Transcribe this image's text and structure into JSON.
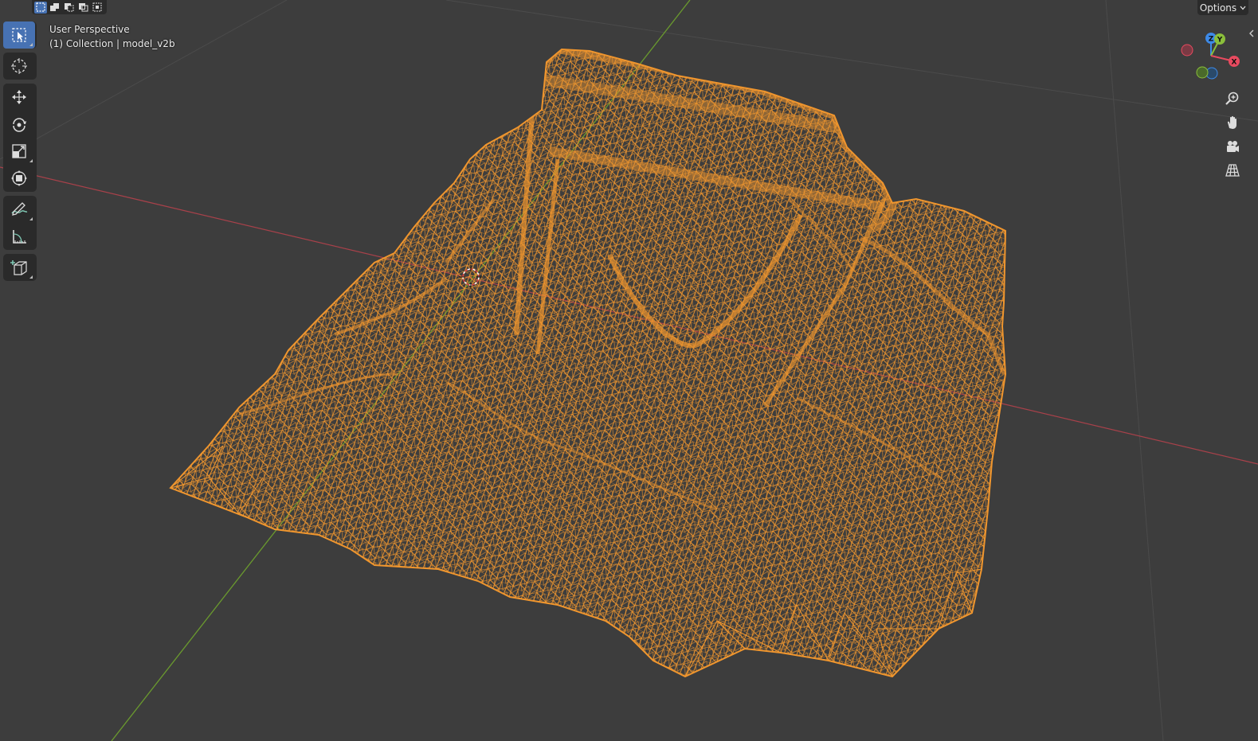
{
  "viewport": {
    "view_name": "User Perspective",
    "collection_line": "(1) Collection | model_v2b",
    "options_label": "Options",
    "options_icon": "chevron-down-icon"
  },
  "selection_modes": [
    {
      "name": "mode-set-new",
      "active": true
    },
    {
      "name": "mode-extend",
      "active": false
    },
    {
      "name": "mode-subtract",
      "active": false
    },
    {
      "name": "mode-difference",
      "active": false
    },
    {
      "name": "mode-intersect",
      "active": false
    }
  ],
  "toolbar": {
    "tools": [
      {
        "name": "select-box-tool",
        "icon": "select-box-icon",
        "active": true
      },
      {
        "name": "cursor-tool",
        "icon": "cursor-icon",
        "active": false
      },
      {
        "name": "move-tool",
        "icon": "move-icon",
        "active": false
      },
      {
        "name": "rotate-tool",
        "icon": "rotate-icon",
        "active": false
      },
      {
        "name": "scale-tool",
        "icon": "scale-icon",
        "active": false
      },
      {
        "name": "transform-tool",
        "icon": "transform-icon",
        "active": false
      },
      {
        "name": "annotate-tool",
        "icon": "annotate-icon",
        "active": false
      },
      {
        "name": "measure-tool",
        "icon": "measure-icon",
        "active": false
      },
      {
        "name": "add-cube-tool",
        "icon": "add-cube-icon",
        "active": false
      }
    ]
  },
  "gizmo": {
    "axes": [
      "Z",
      "Y",
      "X"
    ],
    "colors": {
      "x": "#e84a5f",
      "y": "#8bbf3b",
      "z": "#3d8ae8"
    }
  },
  "nav_buttons": [
    "zoom-icon",
    "hand-pan-icon",
    "camera-icon",
    "grid-perspective-icon"
  ],
  "colors": {
    "background": "#3d3d3d",
    "mesh_wire": "#f0962e",
    "axis_x": "#a8414a",
    "axis_y": "#6a9a2e",
    "grid": "#4a4a4a",
    "accent": "#4772b3"
  }
}
